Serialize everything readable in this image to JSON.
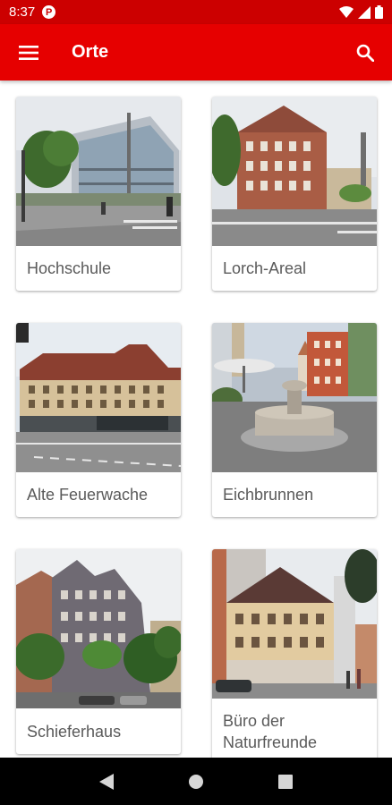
{
  "status_bar": {
    "time": "8:37",
    "badge": "P"
  },
  "app_bar": {
    "title": "Orte"
  },
  "places": [
    {
      "name": "Hochschule"
    },
    {
      "name": "Lorch-Areal"
    },
    {
      "name": "Alte Feuerwache"
    },
    {
      "name": "Eichbrunnen"
    },
    {
      "name": "Schieferhaus"
    },
    {
      "name": "Büro der Naturfreunde"
    }
  ],
  "colors": {
    "primary": "#e60000",
    "status": "#cc0000",
    "nav": "#000000"
  },
  "icons": {
    "menu": "hamburger-icon",
    "search": "search-icon",
    "back": "back-icon",
    "home": "home-icon",
    "recents": "recents-icon"
  }
}
